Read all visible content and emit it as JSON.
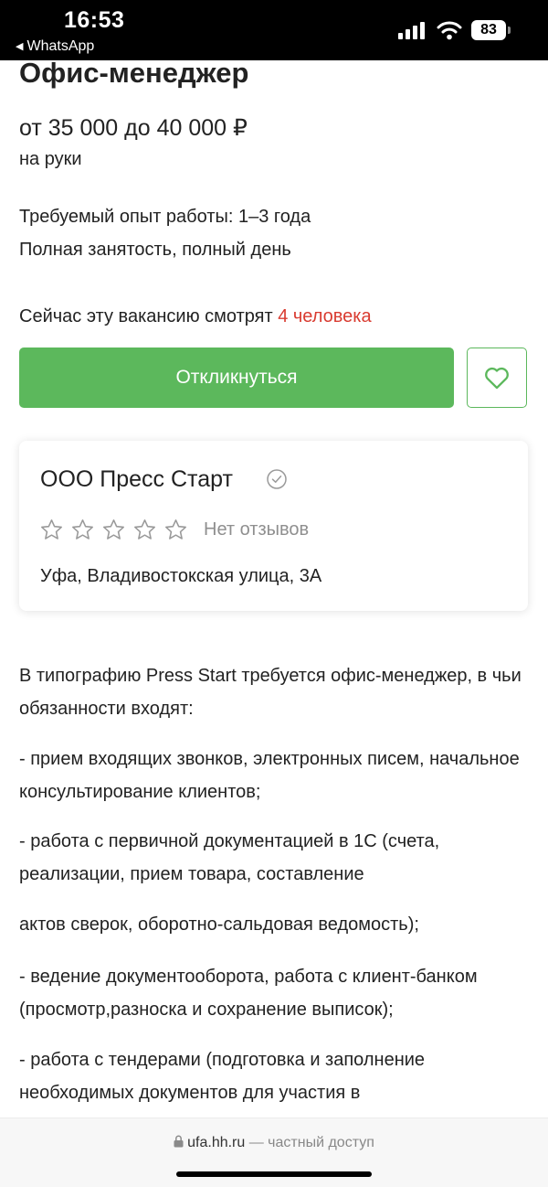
{
  "status_bar": {
    "time": "16:53",
    "back_label": "WhatsApp",
    "battery": "83"
  },
  "vacancy": {
    "title": "Офис-менеджер",
    "salary": "от 35 000 до 40 000 ₽",
    "salary_note": "на руки",
    "experience": "Требуемый опыт работы: 1–3 года",
    "employment": "Полная занятость, полный день",
    "viewers_text": "Сейчас эту вакансию смотрят",
    "viewers_count": "4 человека"
  },
  "actions": {
    "apply_label": "Откликнуться",
    "favorite_icon": "heart-icon"
  },
  "company": {
    "name": "ООО Пресс Старт",
    "verified_icon": "check-circle-icon",
    "rating": 0,
    "rating_max": 5,
    "reviews_label": "Нет отзывов",
    "address": "Уфа, Владивостокская улица, 3А"
  },
  "description": [
    "В типографию Press Start требуется офис-менеджер, в чьи обязанности входят:",
    "- прием входящих звонков, электронных писем, начальное консультирование клиентов;",
    "- работа с первичной документацией в 1С (счета, реализации, прием товара, составление",
    "актов сверок, оборотно-сальдовая ведомость);",
    "- ведение документооборота, работа с клиент-банком (просмотр,разноска и сохранение выписок);",
    "- работа с тендерами (подготовка и заполнение необходимых документов для участия в"
  ],
  "browser": {
    "domain": "ufa.hh.ru",
    "access_note": "— частный доступ"
  },
  "colors": {
    "accent_green": "#5cb85c",
    "highlight_red": "#d93b30"
  }
}
